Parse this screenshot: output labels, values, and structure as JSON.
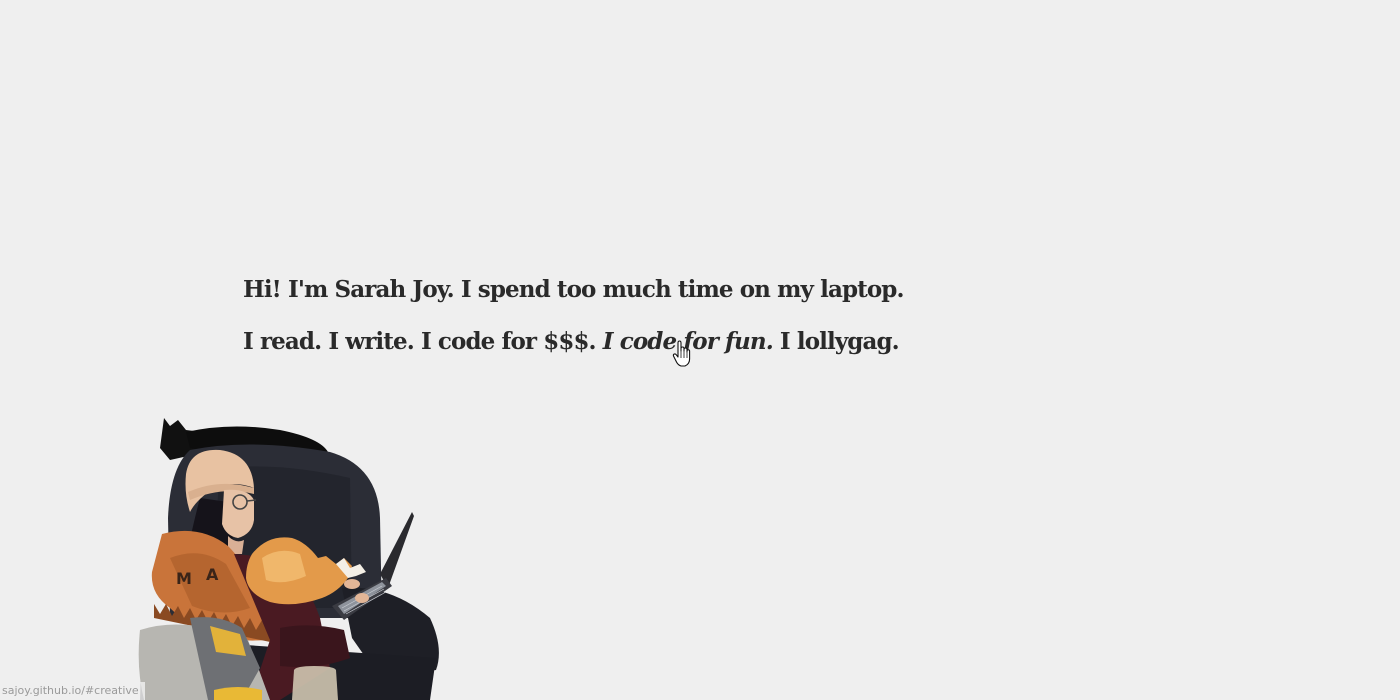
{
  "intro": {
    "line1": "Hi! I'm Sarah Joy. I spend too much time on my laptop.",
    "line2": {
      "read": "I read.",
      "write": "I write.",
      "code_money": "I code for $$$.",
      "code_fun": "I code for fun.",
      "lollygag": "I lollygag."
    }
  },
  "status_url": "sajoy.github.io/#creative",
  "icons": {
    "cursor": "hand-pointer-icon"
  },
  "colors": {
    "background": "#efefef",
    "text": "#2a2a2a",
    "status_text": "#9a9a9a"
  }
}
